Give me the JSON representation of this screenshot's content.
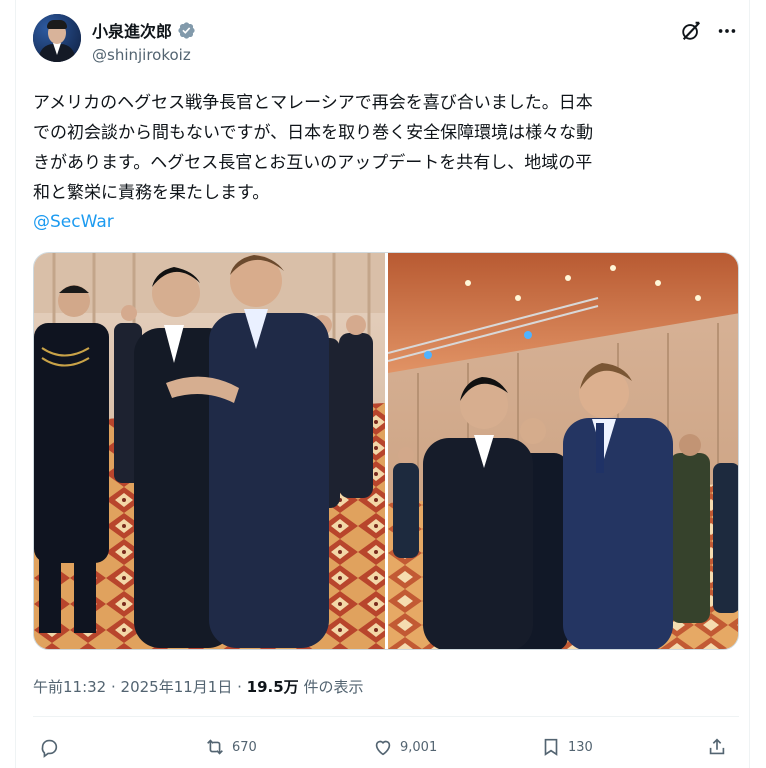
{
  "author": {
    "display_name": "小泉進次郎",
    "handle": "@shinjirokoiz",
    "verified": true,
    "verified_color": "#829aab"
  },
  "post": {
    "text_lines": [
      "アメリカのヘグセス戦争長官とマレーシアで再会を喜び合いました。日本",
      "での初会談から間もないですが、日本を取り巻く安全保障環境は様々な動",
      "きがあります。ヘグセス長官とお互いのアップデートを共有し、地域の平",
      "和と繁栄に責務を果たします。"
    ],
    "mention": "@SecWar",
    "mention_color": "#1d9bf0"
  },
  "media": {
    "count": 2,
    "icons": [
      "photo-left",
      "photo-right"
    ]
  },
  "meta": {
    "time_date": "午前11:32 · 2025年11月1日 · ",
    "views_count": "19.5万",
    "views_label": " 件の表示"
  },
  "actions": {
    "reply_count": "",
    "retweet_count": "670",
    "like_count": "9,001",
    "bookmark_count": "130"
  },
  "icons": {
    "grok": "grok-icon",
    "more": "more-icon",
    "reply": "reply-icon",
    "retweet": "retweet-icon",
    "like": "heart-icon",
    "bookmark": "bookmark-icon",
    "share": "share-icon"
  }
}
